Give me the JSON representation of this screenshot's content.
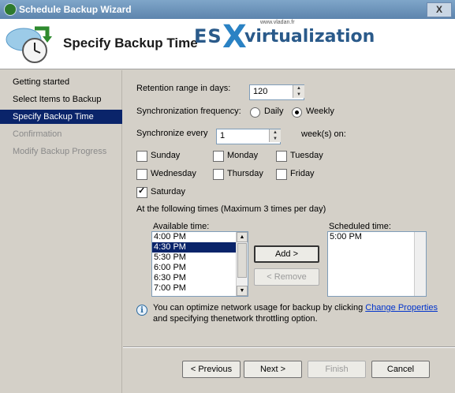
{
  "window": {
    "title": "Schedule Backup Wizard",
    "close_label": "X"
  },
  "header": {
    "title": "Specify Backup Time",
    "logo": {
      "small": "www.vladan.fr",
      "es": "ES",
      "x": "X",
      "rest": "virtualization"
    }
  },
  "nav": {
    "items": [
      {
        "label": "Getting started",
        "state": "done"
      },
      {
        "label": "Select Items to Backup",
        "state": "done"
      },
      {
        "label": "Specify Backup Time",
        "state": "selected"
      },
      {
        "label": "Confirmation",
        "state": "disabled"
      },
      {
        "label": "Modify Backup Progress",
        "state": "disabled"
      }
    ]
  },
  "form": {
    "retention_label": "Retention range in days:",
    "retention_value": "120",
    "sync_freq_label": "Synchronization frequency:",
    "freq_daily": "Daily",
    "freq_weekly": "Weekly",
    "freq_selected": "Weekly",
    "sync_every_label": "Synchronize every",
    "sync_every_value": "1",
    "weeks_on_label": "week(s) on:",
    "days": [
      {
        "label": "Sunday",
        "checked": false
      },
      {
        "label": "Monday",
        "checked": false
      },
      {
        "label": "Tuesday",
        "checked": false
      },
      {
        "label": "Wednesday",
        "checked": false
      },
      {
        "label": "Thursday",
        "checked": false
      },
      {
        "label": "Friday",
        "checked": false
      },
      {
        "label": "Saturday",
        "checked": true
      }
    ],
    "times_label": "At the following times (Maximum 3 times per day)",
    "available_label": "Available time:",
    "available_times": [
      "4:00 PM",
      "4:30 PM",
      "5:30 PM",
      "6:00 PM",
      "6:30 PM",
      "7:00 PM"
    ],
    "available_selected": "4:30 PM",
    "add_label": "Add >",
    "remove_label": "< Remove",
    "scheduled_label": "Scheduled time:",
    "scheduled_times": [
      "5:00 PM"
    ]
  },
  "info": {
    "text_before": "You can optimize network usage for backup by clicking ",
    "link": "Change Properties",
    "text_after": " and specifying thenetwork throttling option."
  },
  "footer": {
    "previous": "< Previous",
    "next": "Next >",
    "finish": "Finish",
    "cancel": "Cancel"
  }
}
